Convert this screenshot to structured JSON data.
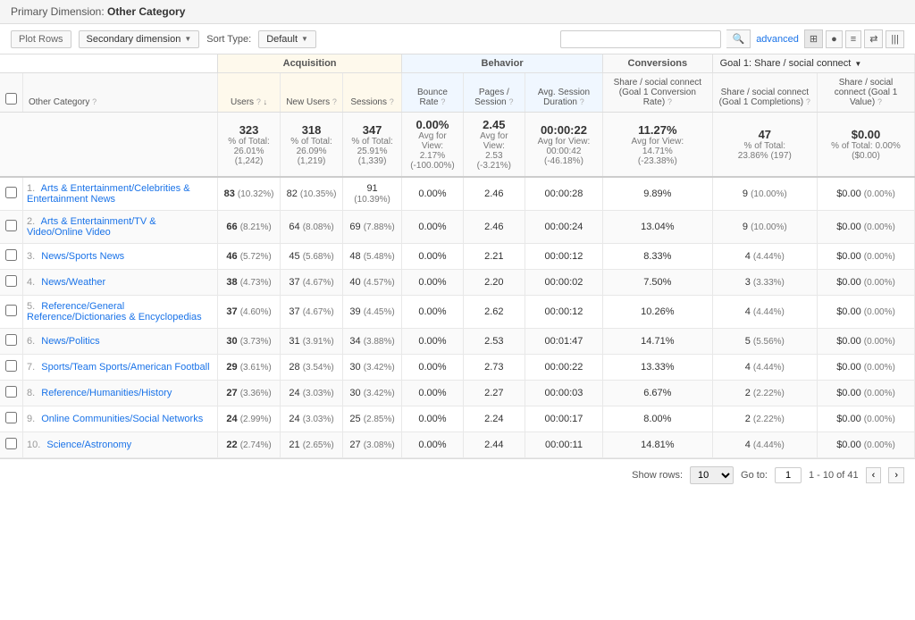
{
  "primary_dimension": {
    "label": "Primary Dimension:",
    "value": "Other Category"
  },
  "toolbar": {
    "plot_rows": "Plot Rows",
    "secondary_dimension": "Secondary dimension",
    "sort_type": "Sort Type:",
    "sort_default": "Default",
    "search_placeholder": "",
    "advanced": "advanced"
  },
  "view_icons": [
    "⊞",
    "●",
    "≡",
    "⇄",
    "|||"
  ],
  "group_headers": {
    "acquisition": "Acquisition",
    "behavior": "Behavior",
    "conversions": "Conversions",
    "goal": "Goal 1: Share / social connect"
  },
  "columns": {
    "category": "Other Category",
    "category_help": true,
    "users": "Users",
    "new_users": "New Users",
    "sessions": "Sessions",
    "bounce_rate": "Bounce Rate",
    "pages_session": "Pages / Session",
    "avg_session": "Avg. Session Duration",
    "share_conversion_rate": "Share / social connect (Goal 1 Conversion Rate)",
    "share_completions": "Share / social connect (Goal 1 Completions)",
    "share_value": "Share / social connect (Goal 1 Value)"
  },
  "summary": {
    "users_main": "323",
    "users_sub1": "% of Total:",
    "users_sub2": "26.01%",
    "users_sub3": "(1,242)",
    "new_users_main": "318",
    "new_users_sub1": "% of Total:",
    "new_users_sub2": "26.09%",
    "new_users_sub3": "(1,219)",
    "sessions_main": "347",
    "sessions_sub1": "% of Total:",
    "sessions_sub2": "25.91%",
    "sessions_sub3": "(1,339)",
    "bounce_main": "0.00%",
    "bounce_sub1": "Avg for View:",
    "bounce_sub2": "2.17%",
    "bounce_sub3": "(-100.00%)",
    "pages_main": "2.45",
    "pages_sub1": "Avg for View:",
    "pages_sub2": "2.53",
    "pages_sub3": "(-3.21%)",
    "avg_sess_main": "00:00:22",
    "avg_sess_sub1": "Avg for View:",
    "avg_sess_sub2": "00:00:42",
    "avg_sess_sub3": "(-46.18%)",
    "conv_rate_main": "11.27%",
    "conv_rate_sub1": "Avg for View:",
    "conv_rate_sub2": "14.71%",
    "conv_rate_sub3": "(-23.38%)",
    "completions_main": "47",
    "completions_sub1": "% of Total:",
    "completions_sub2": "23.86% (197)",
    "value_main": "$0.00",
    "value_sub1": "% of Total: 0.00%",
    "value_sub2": "($0.00)"
  },
  "rows": [
    {
      "num": "1.",
      "category": "Arts & Entertainment/Celebrities & Entertainment News",
      "users": "83",
      "users_pct": "(10.32%)",
      "new_users": "82",
      "new_users_pct": "(10.35%)",
      "sessions": "91",
      "sessions_pct": "(10.39%)",
      "bounce_rate": "0.00%",
      "pages_session": "2.46",
      "avg_session": "00:00:28",
      "conv_rate": "9.89%",
      "completions": "9",
      "completions_pct": "(10.00%)",
      "value": "$0.00",
      "value_pct": "(0.00%)"
    },
    {
      "num": "2.",
      "category": "Arts & Entertainment/TV & Video/Online Video",
      "users": "66",
      "users_pct": "(8.21%)",
      "new_users": "64",
      "new_users_pct": "(8.08%)",
      "sessions": "69",
      "sessions_pct": "(7.88%)",
      "bounce_rate": "0.00%",
      "pages_session": "2.46",
      "avg_session": "00:00:24",
      "conv_rate": "13.04%",
      "completions": "9",
      "completions_pct": "(10.00%)",
      "value": "$0.00",
      "value_pct": "(0.00%)"
    },
    {
      "num": "3.",
      "category": "News/Sports News",
      "users": "46",
      "users_pct": "(5.72%)",
      "new_users": "45",
      "new_users_pct": "(5.68%)",
      "sessions": "48",
      "sessions_pct": "(5.48%)",
      "bounce_rate": "0.00%",
      "pages_session": "2.21",
      "avg_session": "00:00:12",
      "conv_rate": "8.33%",
      "completions": "4",
      "completions_pct": "(4.44%)",
      "value": "$0.00",
      "value_pct": "(0.00%)"
    },
    {
      "num": "4.",
      "category": "News/Weather",
      "users": "38",
      "users_pct": "(4.73%)",
      "new_users": "37",
      "new_users_pct": "(4.67%)",
      "sessions": "40",
      "sessions_pct": "(4.57%)",
      "bounce_rate": "0.00%",
      "pages_session": "2.20",
      "avg_session": "00:00:02",
      "conv_rate": "7.50%",
      "completions": "3",
      "completions_pct": "(3.33%)",
      "value": "$0.00",
      "value_pct": "(0.00%)"
    },
    {
      "num": "5.",
      "category": "Reference/General Reference/Dictionaries & Encyclopedias",
      "users": "37",
      "users_pct": "(4.60%)",
      "new_users": "37",
      "new_users_pct": "(4.67%)",
      "sessions": "39",
      "sessions_pct": "(4.45%)",
      "bounce_rate": "0.00%",
      "pages_session": "2.62",
      "avg_session": "00:00:12",
      "conv_rate": "10.26%",
      "completions": "4",
      "completions_pct": "(4.44%)",
      "value": "$0.00",
      "value_pct": "(0.00%)"
    },
    {
      "num": "6.",
      "category": "News/Politics",
      "users": "30",
      "users_pct": "(3.73%)",
      "new_users": "31",
      "new_users_pct": "(3.91%)",
      "sessions": "34",
      "sessions_pct": "(3.88%)",
      "bounce_rate": "0.00%",
      "pages_session": "2.53",
      "avg_session": "00:01:47",
      "conv_rate": "14.71%",
      "completions": "5",
      "completions_pct": "(5.56%)",
      "value": "$0.00",
      "value_pct": "(0.00%)"
    },
    {
      "num": "7.",
      "category": "Sports/Team Sports/American Football",
      "users": "29",
      "users_pct": "(3.61%)",
      "new_users": "28",
      "new_users_pct": "(3.54%)",
      "sessions": "30",
      "sessions_pct": "(3.42%)",
      "bounce_rate": "0.00%",
      "pages_session": "2.73",
      "avg_session": "00:00:22",
      "conv_rate": "13.33%",
      "completions": "4",
      "completions_pct": "(4.44%)",
      "value": "$0.00",
      "value_pct": "(0.00%)"
    },
    {
      "num": "8.",
      "category": "Reference/Humanities/History",
      "users": "27",
      "users_pct": "(3.36%)",
      "new_users": "24",
      "new_users_pct": "(3.03%)",
      "sessions": "30",
      "sessions_pct": "(3.42%)",
      "bounce_rate": "0.00%",
      "pages_session": "2.27",
      "avg_session": "00:00:03",
      "conv_rate": "6.67%",
      "completions": "2",
      "completions_pct": "(2.22%)",
      "value": "$0.00",
      "value_pct": "(0.00%)"
    },
    {
      "num": "9.",
      "category": "Online Communities/Social Networks",
      "users": "24",
      "users_pct": "(2.99%)",
      "new_users": "24",
      "new_users_pct": "(3.03%)",
      "sessions": "25",
      "sessions_pct": "(2.85%)",
      "bounce_rate": "0.00%",
      "pages_session": "2.24",
      "avg_session": "00:00:17",
      "conv_rate": "8.00%",
      "completions": "2",
      "completions_pct": "(2.22%)",
      "value": "$0.00",
      "value_pct": "(0.00%)"
    },
    {
      "num": "10.",
      "category": "Science/Astronomy",
      "users": "22",
      "users_pct": "(2.74%)",
      "new_users": "21",
      "new_users_pct": "(2.65%)",
      "sessions": "27",
      "sessions_pct": "(3.08%)",
      "bounce_rate": "0.00%",
      "pages_session": "2.44",
      "avg_session": "00:00:11",
      "conv_rate": "14.81%",
      "completions": "4",
      "completions_pct": "(4.44%)",
      "value": "$0.00",
      "value_pct": "(0.00%)"
    }
  ],
  "footer": {
    "show_rows_label": "Show rows:",
    "show_rows_value": "10",
    "go_to_label": "Go to:",
    "go_to_value": "1",
    "range_label": "1 - 10 of 41"
  }
}
